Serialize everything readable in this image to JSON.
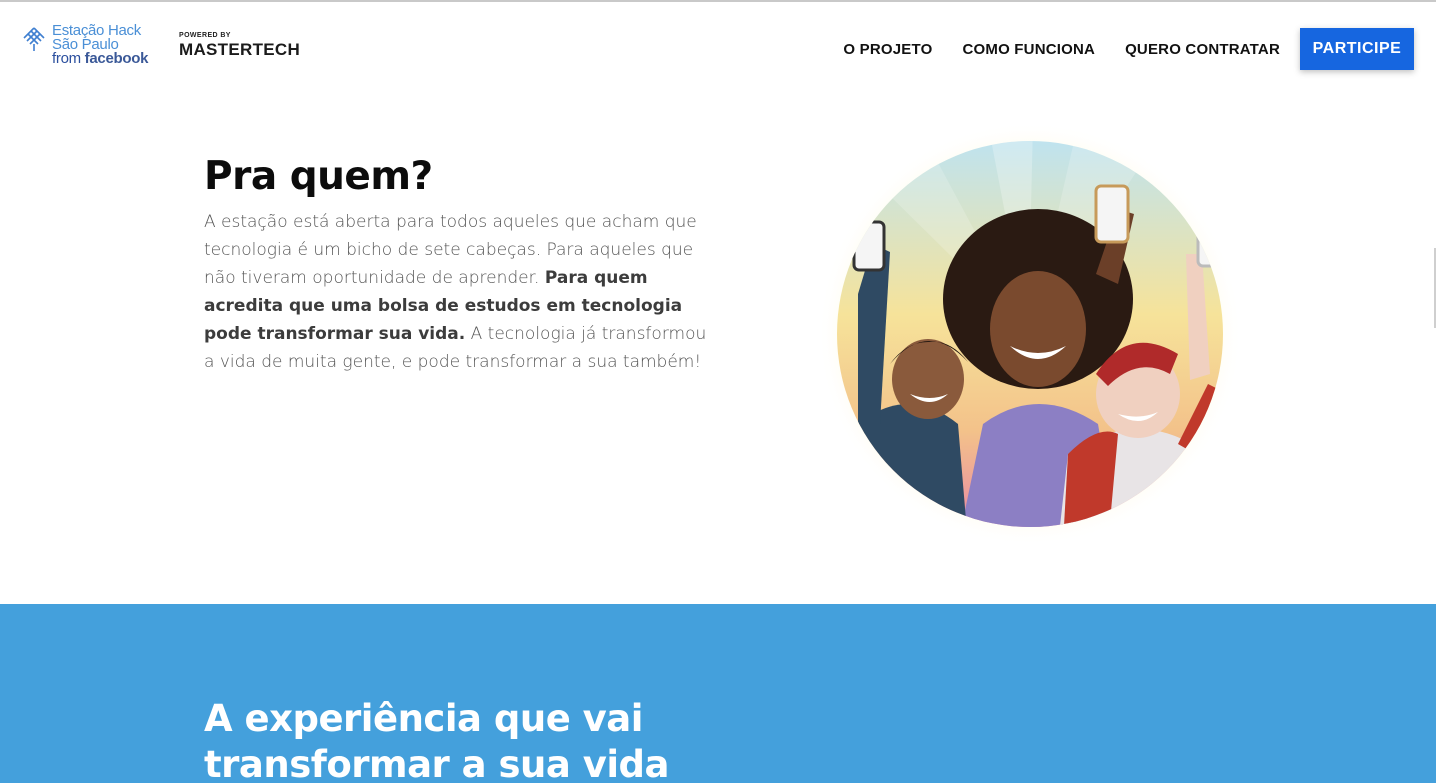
{
  "header": {
    "brand_line1": "Estação Hack",
    "brand_line2": "São Paulo",
    "brand_line3_prefix": "from ",
    "brand_line3_fb": "facebook",
    "powered_small": "POWERED BY",
    "powered_big": "MASTERTECH",
    "nav": [
      {
        "label": "O PROJETO"
      },
      {
        "label": "COMO FUNCIONA"
      },
      {
        "label": "QUERO CONTRATAR"
      }
    ],
    "cta_label": "PARTICIPE"
  },
  "who": {
    "title": "Pra quem?",
    "body_part1": "A estação está aberta para todos aqueles que acham que tecnologia é um bicho de sete cabeças. Para aqueles que não tiveram oportunidade de aprender. ",
    "body_bold": "Para quem acredita que uma bolsa de estudos em tecnologia pode transformar sua vida.",
    "body_part2": " A tecnologia já transformou a vida de muita gente, e pode transformar a sua também!"
  },
  "experience": {
    "title": "A experiência que vai transformar a sua vida"
  },
  "colors": {
    "accent": "#1666e0",
    "section_blue": "#44a0dc",
    "brand_blue": "#4a8fd6",
    "facebook": "#3b5998"
  },
  "icons": {
    "brand": "estacao-hack-logo-icon"
  }
}
